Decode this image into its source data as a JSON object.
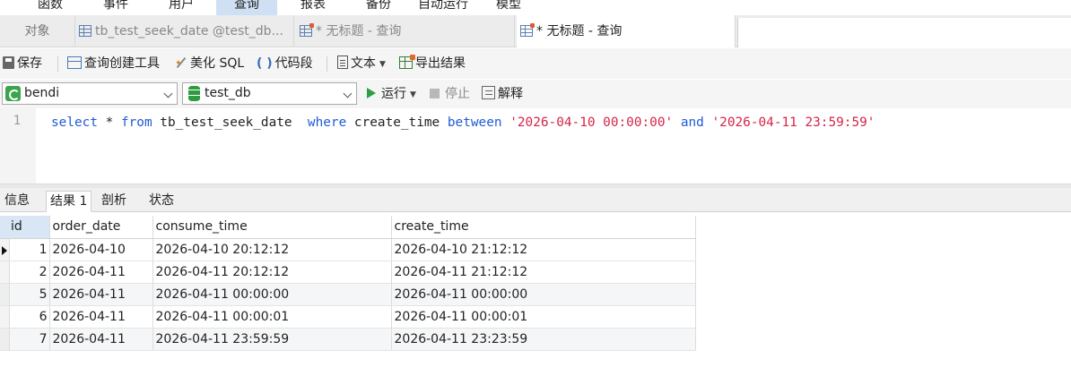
{
  "menu": {
    "items": [
      "函数",
      "事件",
      "用户",
      "查询",
      "报表",
      "备份",
      "自动运行",
      "模型"
    ],
    "active": "查询"
  },
  "tabs": {
    "objects": "对象",
    "tab1": "tb_test_seek_date @test_db...",
    "tab2": "* 无标题 - 查询",
    "tab3": "* 无标题 - 查询"
  },
  "toolbar": {
    "save": "保存",
    "query_builder": "查询创建工具",
    "beautify": "美化 SQL",
    "snippet": "代码段",
    "text": "文本",
    "export": "导出结果"
  },
  "connection": {
    "conn_value": "bendi",
    "db_value": "test_db",
    "run": "运行",
    "stop": "停止",
    "explain": "解释",
    "accent": "#2ea043"
  },
  "editor": {
    "line_number": "1",
    "tokens": {
      "t1": "select",
      "t2": " * ",
      "t3": "from",
      "t4": " tb_test_seek_date  ",
      "t5": "where",
      "t6": " create_time ",
      "t7": "between",
      "t8": " ",
      "t9": "'2026-04-10 00:00:00'",
      "t10": " ",
      "t11": "and",
      "t12": " ",
      "t13": "'2026-04-11 23:59:59'"
    },
    "keyword_color": "#1f5bd6",
    "string_color": "#d6244a"
  },
  "result_tabs": [
    "信息",
    "结果 1",
    "剖析",
    "状态"
  ],
  "result_active": "结果 1",
  "grid": {
    "headers": [
      "id",
      "order_date",
      "consume_time",
      "create_time"
    ],
    "rows": [
      [
        "1",
        "2026-04-10",
        "2026-04-10 20:12:12",
        "2026-04-10 21:12:12"
      ],
      [
        "2",
        "2026-04-11",
        "2026-04-11 20:12:12",
        "2026-04-11 21:12:12"
      ],
      [
        "5",
        "2026-04-11",
        "2026-04-11 00:00:00",
        "2026-04-11 00:00:00"
      ],
      [
        "6",
        "2026-04-11",
        "2026-04-11 00:00:01",
        "2026-04-11 00:00:01"
      ],
      [
        "7",
        "2026-04-11",
        "2026-04-11 23:59:59",
        "2026-04-11 23:23:59"
      ]
    ]
  }
}
